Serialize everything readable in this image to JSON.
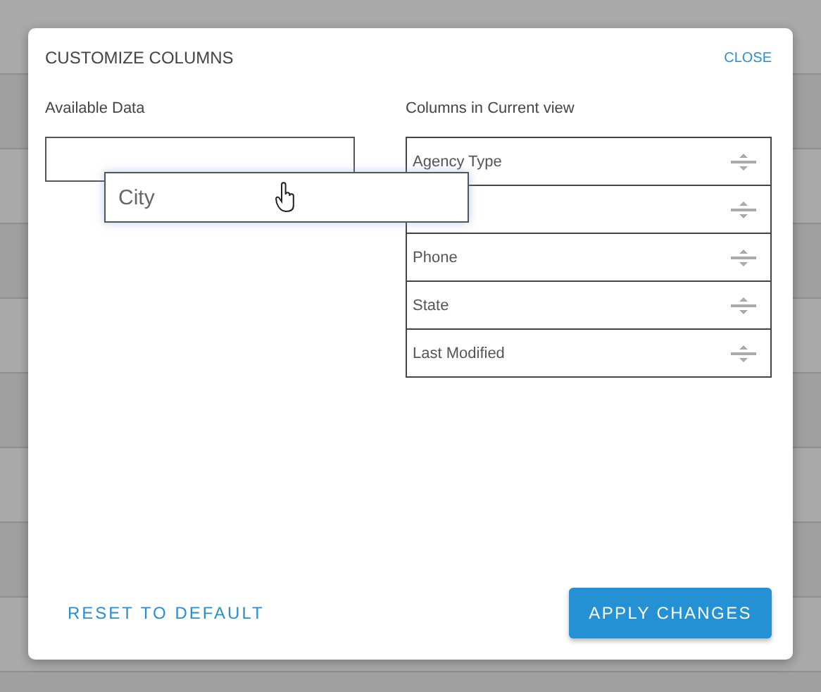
{
  "dialog": {
    "title": "CUSTOMIZE COLUMNS",
    "close": "CLOSE",
    "available": {
      "label": "Available Data",
      "dragging": "City"
    },
    "current": {
      "label": "Columns in Current view",
      "items": [
        {
          "kind": "column",
          "label": "Agency Type"
        },
        {
          "kind": "hidden"
        },
        {
          "kind": "column",
          "label": "Phone"
        },
        {
          "kind": "column",
          "label": "State"
        },
        {
          "kind": "column",
          "label": "Last Modified"
        }
      ]
    },
    "reset": "RESET TO DEFAULT",
    "apply": "APPLY CHANGES"
  }
}
